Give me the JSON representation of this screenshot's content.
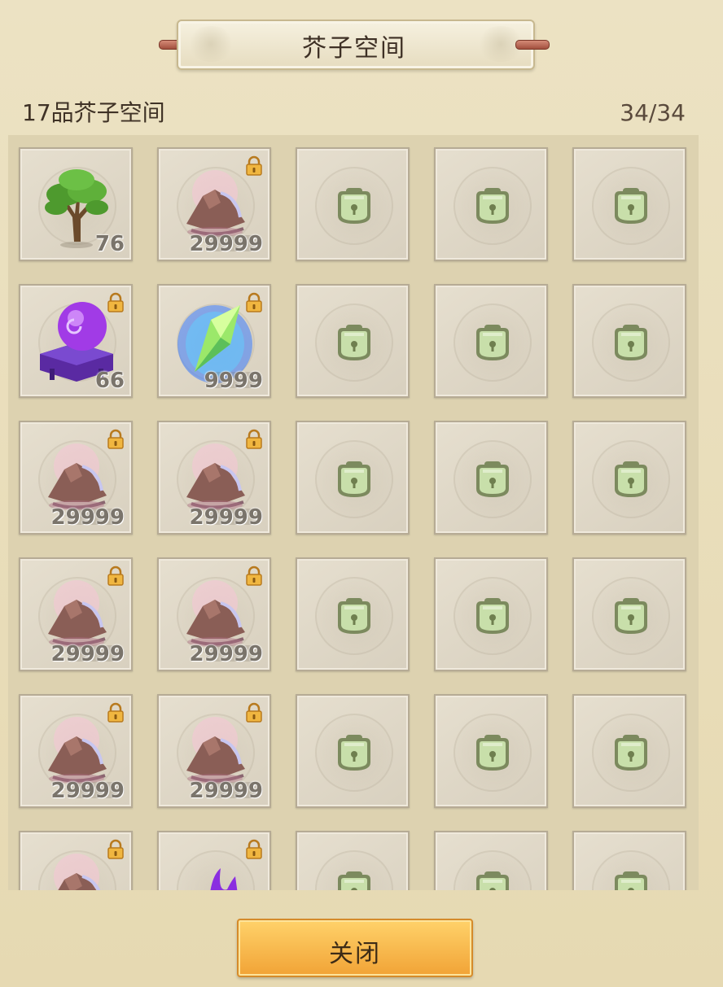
{
  "header": {
    "title": "芥子空间",
    "subtitle": "17品芥子空间",
    "capacity": "34/34"
  },
  "slots": [
    {
      "item": "tree",
      "count": "76",
      "locked": false
    },
    {
      "item": "ore",
      "count": "29999",
      "locked": true
    },
    {
      "item": "empty-locked"
    },
    {
      "item": "empty-locked"
    },
    {
      "item": "empty-locked"
    },
    {
      "item": "orb",
      "count": "66",
      "locked": true
    },
    {
      "item": "crystal",
      "count": "9999",
      "locked": true
    },
    {
      "item": "empty-locked"
    },
    {
      "item": "empty-locked"
    },
    {
      "item": "empty-locked"
    },
    {
      "item": "ore",
      "count": "29999",
      "locked": true
    },
    {
      "item": "ore",
      "count": "29999",
      "locked": true
    },
    {
      "item": "empty-locked"
    },
    {
      "item": "empty-locked"
    },
    {
      "item": "empty-locked"
    },
    {
      "item": "ore",
      "count": "29999",
      "locked": true
    },
    {
      "item": "ore",
      "count": "29999",
      "locked": true
    },
    {
      "item": "empty-locked"
    },
    {
      "item": "empty-locked"
    },
    {
      "item": "empty-locked"
    },
    {
      "item": "ore",
      "count": "29999",
      "locked": true
    },
    {
      "item": "ore",
      "count": "29999",
      "locked": true
    },
    {
      "item": "empty-locked"
    },
    {
      "item": "empty-locked"
    },
    {
      "item": "empty-locked"
    },
    {
      "item": "ore",
      "count": "",
      "locked": true
    },
    {
      "item": "purple-flame",
      "count": "",
      "locked": true
    },
    {
      "item": "empty-locked"
    },
    {
      "item": "empty-locked"
    },
    {
      "item": "empty-locked"
    }
  ],
  "footer": {
    "close_label": "关闭"
  },
  "colors": {
    "background": "#e8dcb8",
    "button": "#f1a336",
    "lock_gold": "#e8a53a",
    "slot_lock_green": "#b9d39a"
  }
}
